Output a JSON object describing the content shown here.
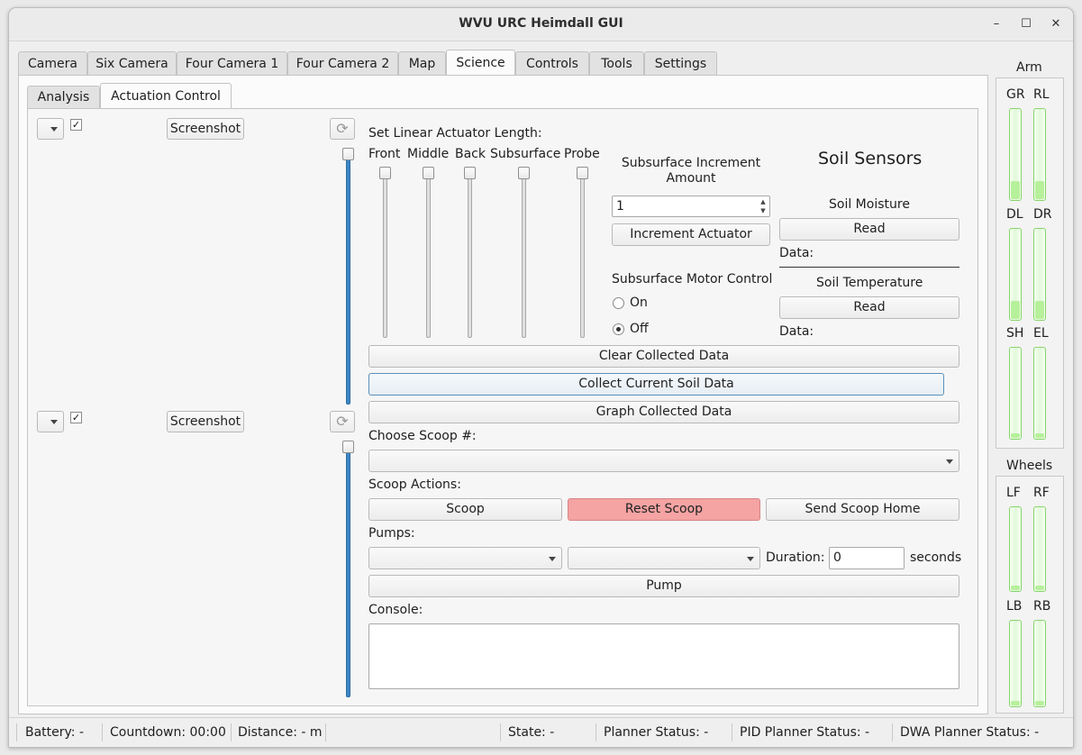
{
  "window": {
    "title": "WVU URC Heimdall GUI",
    "minimize": "–",
    "maximize": "☐",
    "close": "✕"
  },
  "main_tabs": [
    "Camera",
    "Six Camera",
    "Four Camera 1",
    "Four Camera 2",
    "Map",
    "Science",
    "Controls",
    "Tools",
    "Settings"
  ],
  "sub_tabs": [
    "Analysis",
    "Actuation Control"
  ],
  "camera_panels": [
    {
      "screenshot_label": "Screenshot",
      "checked": "✓",
      "refresh": "⟳"
    },
    {
      "screenshot_label": "Screenshot",
      "checked": "✓",
      "refresh": "⟳"
    }
  ],
  "actuator": {
    "title": "Set Linear Actuator Length:",
    "sliders": [
      "Front",
      "Middle",
      "Back",
      "Subsurface",
      "Probe"
    ]
  },
  "subsurface": {
    "increment_label": "Subsurface Increment Amount",
    "increment_value": "1",
    "increment_button": "Increment Actuator",
    "motor_label": "Subsurface Motor Control",
    "on_label": "On",
    "off_label": "Off",
    "selected": "Off"
  },
  "soil": {
    "title": "Soil Sensors",
    "moisture_label": "Soil Moisture",
    "moisture_read": "Read",
    "moisture_data": "Data:",
    "temp_label": "Soil Temperature",
    "temp_read": "Read",
    "temp_data": "Data:"
  },
  "data_buttons": {
    "clear": "Clear Collected Data",
    "collect": "Collect Current Soil Data",
    "graph": "Graph Collected Data"
  },
  "scoop": {
    "choose_label": "Choose Scoop #:",
    "actions_label": "Scoop Actions:",
    "scoop_button": "Scoop",
    "reset_button": "Reset Scoop",
    "home_button": "Send Scoop Home"
  },
  "pumps": {
    "label": "Pumps:",
    "duration_label": "Duration:",
    "duration_value": "0",
    "seconds_label": "seconds",
    "pump_button": "Pump"
  },
  "console": {
    "label": "Console:"
  },
  "arm": {
    "title": "Arm",
    "bars": [
      {
        "label": "GR",
        "level": 0.2
      },
      {
        "label": "RL",
        "level": 0.2
      },
      {
        "label": "DL",
        "level": 0.2
      },
      {
        "label": "DR",
        "level": 0.2
      },
      {
        "label": "SH",
        "level": 0.05
      },
      {
        "label": "EL",
        "level": 0.05
      }
    ]
  },
  "wheels": {
    "title": "Wheels",
    "bars": [
      {
        "label": "LF",
        "level": 0.05
      },
      {
        "label": "RF",
        "level": 0.05
      },
      {
        "label": "LB",
        "level": 0.05
      },
      {
        "label": "RB",
        "level": 0.05
      }
    ]
  },
  "status_bar": {
    "battery": "Battery:  -",
    "countdown": "Countdown:  00:00",
    "distance": "Distance:  - m",
    "state": "State:  -",
    "planner": "Planner Status:  -",
    "pid": "PID Planner Status:  -",
    "dwa": "DWA Planner Status:  -"
  }
}
